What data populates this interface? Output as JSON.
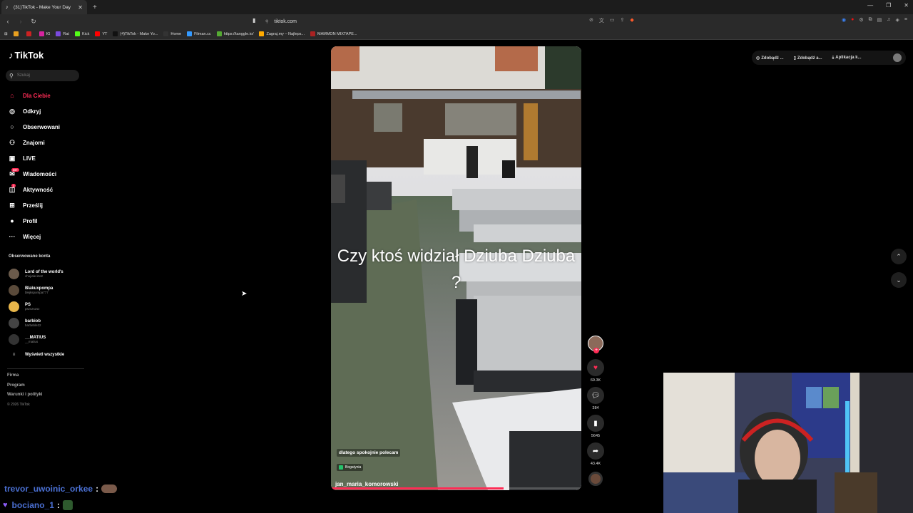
{
  "browser": {
    "tab_title": "(31)TikTok - Make Your Day",
    "tab_favicon": "tiktok-icon",
    "new_tab": "+",
    "url": "tiktok.com",
    "bookmarks": [
      {
        "label": "",
        "color": "#e8a020"
      },
      {
        "label": "",
        "color": "#cc2222"
      },
      {
        "label": "IG",
        "color": "#d6249f"
      },
      {
        "label": "Rat",
        "color": "#7a4adf"
      },
      {
        "label": "Kick",
        "color": "#53fc18"
      },
      {
        "label": "YT",
        "color": "#ff0000"
      },
      {
        "label": "(4)TikTok - Make Yo...",
        "color": "#111111"
      },
      {
        "label": "Home",
        "color": "#333333"
      },
      {
        "label": "Filman.cc",
        "color": "#3399ff"
      },
      {
        "label": "https://tanggle.io/",
        "color": "#55aa33"
      },
      {
        "label": "Zagraj.my – Najleps...",
        "color": "#ffaa00"
      },
      {
        "label": "MAMMON MIXTAPE...",
        "color": "#aa2222"
      }
    ]
  },
  "sidebar": {
    "logo": "TikTok",
    "search_placeholder": "Szukaj",
    "nav": [
      {
        "label": "Dla Ciebie",
        "icon": "home-icon",
        "glyph": "⌂",
        "active": true
      },
      {
        "label": "Odkryj",
        "icon": "compass-icon",
        "glyph": "◎"
      },
      {
        "label": "Obserwowani",
        "icon": "following-icon",
        "glyph": "○"
      },
      {
        "label": "Znajomi",
        "icon": "friends-icon",
        "glyph": "⚇"
      },
      {
        "label": "LIVE",
        "icon": "live-icon",
        "glyph": "▣"
      },
      {
        "label": "Wiadomości",
        "icon": "messages-icon",
        "glyph": "✉",
        "badge": "99+"
      },
      {
        "label": "Aktywność",
        "icon": "activity-icon",
        "glyph": "◫",
        "badge": "1"
      },
      {
        "label": "Prześlij",
        "icon": "upload-icon",
        "glyph": "⊞"
      },
      {
        "label": "Profil",
        "icon": "profile-icon",
        "glyph": "●"
      },
      {
        "label": "Więcej",
        "icon": "more-icon",
        "glyph": "···"
      }
    ],
    "following_header": "Obserwowane konta",
    "following": [
      {
        "name": "Lord of the world's",
        "handle": "chujiale.kto2"
      },
      {
        "name": "Blakuxpompa",
        "handle": "blejkspompa777"
      },
      {
        "name": "PS",
        "handle": "pszszszsz"
      },
      {
        "name": "barbiob",
        "handle": "barbeble22"
      },
      {
        "name": "__MATIUS",
        "handle": "__matius"
      }
    ],
    "show_all": "Wyświetl wszystkie",
    "footer": [
      "Firma",
      "Program",
      "Warunki i polityki"
    ],
    "copyright": "© 2026 TikTok"
  },
  "video": {
    "overlay_text": "Czy ktoś widział Dziuba Dziuba ?",
    "caption": "dlatego spokojnie polecam",
    "location": "Bogatynia",
    "author": "jan_maria_komorowski",
    "progress": 0.69
  },
  "actions": {
    "likes": "69.3K",
    "comments": "384",
    "saves": "5645",
    "shares": "43.4K"
  },
  "topright": {
    "item1": "Zdobądź ...",
    "item2": "Zdobądź a...",
    "item3": "Aplikacja k..."
  },
  "chat": [
    {
      "user": "trevor_uwoinic_orkee",
      "emote": "face-emote"
    },
    {
      "user": "bociano_1",
      "emote": "frog-emote"
    }
  ]
}
